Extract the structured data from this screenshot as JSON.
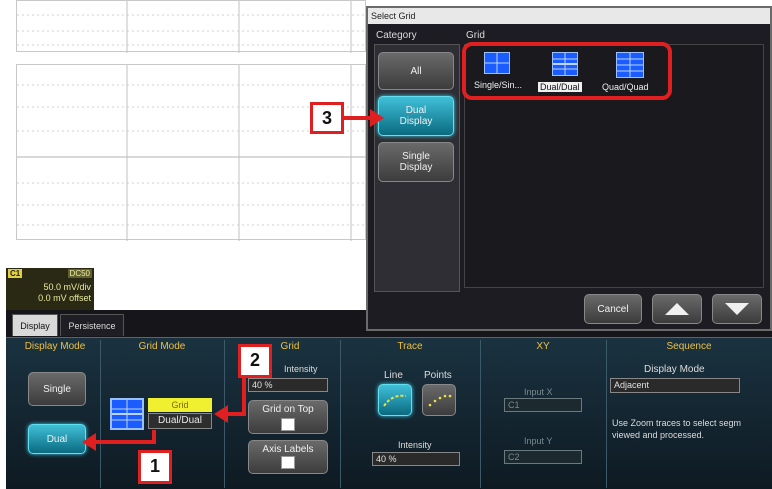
{
  "channel_badge": {
    "channel": "C1",
    "coupling": "DC50",
    "volts_per_div": "50.0 mV/div",
    "offset": "0.0 mV offset"
  },
  "tabs": [
    {
      "label": "Display"
    },
    {
      "label": "Persistence"
    }
  ],
  "sections": {
    "display_mode": {
      "title": "Display Mode",
      "single_label": "Single",
      "dual_label": "Dual"
    },
    "grid_mode": {
      "title": "Grid Mode",
      "grid_tag": "Grid",
      "value": "Dual/Dual"
    },
    "grid": {
      "title": "Grid",
      "intensity_label": "Intensity",
      "intensity_value": "40 %",
      "grid_on_top_label": "Grid on Top",
      "axis_labels_label": "Axis Labels"
    },
    "trace": {
      "title": "Trace",
      "line_label": "Line",
      "points_label": "Points",
      "intensity_label": "Intensity",
      "intensity_value": "40 %"
    },
    "xy": {
      "title": "XY",
      "input_x_label": "Input X",
      "input_x_value": "C1",
      "input_y_label": "Input Y",
      "input_y_value": "C2"
    },
    "sequence": {
      "title": "Sequence",
      "display_mode_label": "Display Mode",
      "display_mode_value": "Adjacent",
      "help_text_1": "Use Zoom traces to select segm",
      "help_text_2": "viewed and processed."
    }
  },
  "dialog": {
    "title": "Select Grid",
    "category_header": "Category",
    "grid_header": "Grid",
    "categories": [
      {
        "label": "All"
      },
      {
        "label_1": "Dual",
        "label_2": "Display"
      },
      {
        "label_1": "Single",
        "label_2": "Display"
      }
    ],
    "grids": [
      {
        "label": "Single/Sin..."
      },
      {
        "label": "Dual/Dual"
      },
      {
        "label": "Quad/Quad"
      }
    ],
    "cancel_label": "Cancel",
    "up_icon": "triangle-up",
    "down_icon": "triangle-down"
  },
  "callouts": [
    {
      "number": "1"
    },
    {
      "number": "2"
    },
    {
      "number": "3"
    }
  ],
  "colors": {
    "callout_red": "#e02020",
    "section_title": "#f0c040",
    "accent_cyan": "#40c0d8",
    "grid_icon_blue": "#1a5cff"
  }
}
